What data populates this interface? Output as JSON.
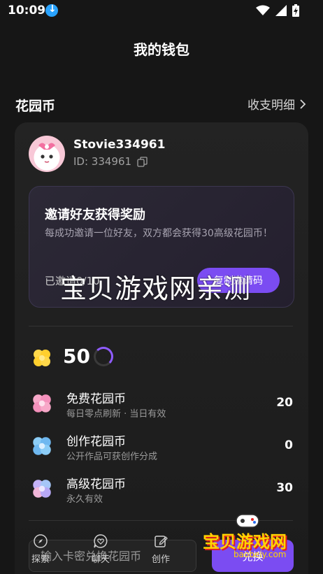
{
  "status": {
    "time": "10:09"
  },
  "page": {
    "title": "我的钱包"
  },
  "section": {
    "title": "花园币",
    "detail_link": "收支明细"
  },
  "user": {
    "name": "Stovie334961",
    "id_text": "ID: 334961"
  },
  "invite": {
    "title": "邀请好友获得奖励",
    "description": "每成功邀请一位好友，双方都会获得30高级花园币！",
    "count": "已邀请0/10",
    "button": "复制邀请码"
  },
  "watermark": {
    "text": "宝贝游戏网亲测",
    "logo": "宝贝游戏网",
    "url": "baobeiy.com"
  },
  "total": {
    "value": "50"
  },
  "coins": [
    {
      "name": "免费花园币",
      "desc": "每日零点刷新 · 当日有效",
      "value": "20",
      "color": "#f7a8c8"
    },
    {
      "name": "创作花园币",
      "desc": "公开作品可获创作分成",
      "value": "0",
      "color": "#8ccdf7"
    },
    {
      "name": "高级花园币",
      "desc": "永久有效",
      "value": "30",
      "color": "#b7a8f5"
    }
  ],
  "redeem": {
    "placeholder": "输入卡密兑换花园币",
    "button": "兑换"
  },
  "nav": [
    {
      "label": "探索",
      "icon": "compass-icon"
    },
    {
      "label": "聊天",
      "icon": "chat-heart-icon"
    },
    {
      "label": "创作",
      "icon": "edit-icon"
    }
  ]
}
